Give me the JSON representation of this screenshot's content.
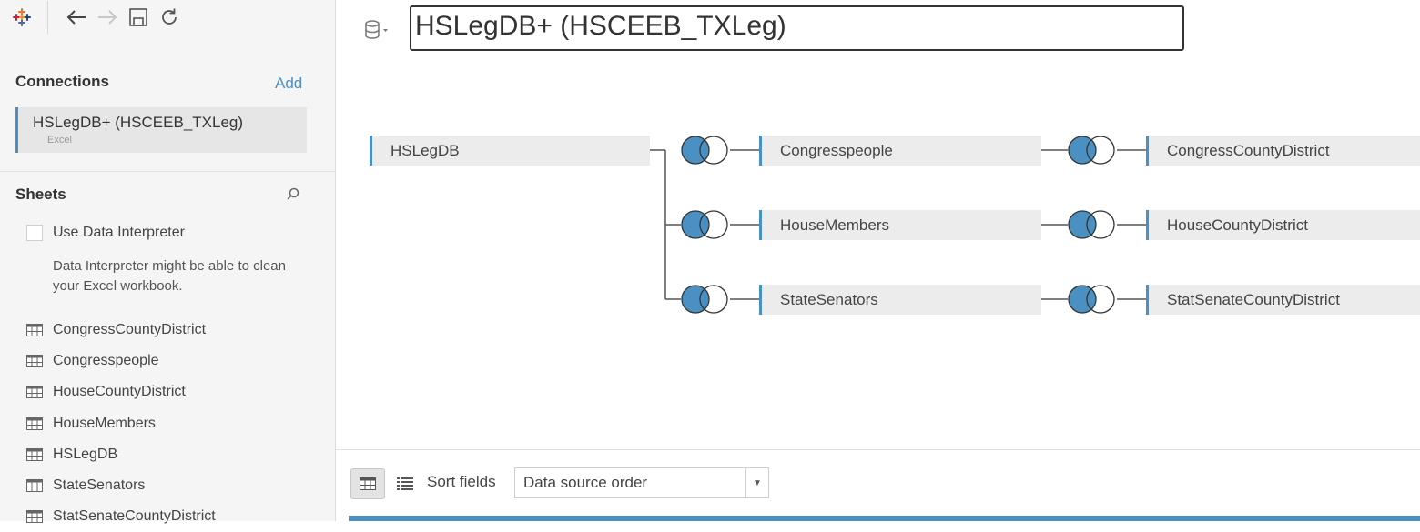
{
  "toolbar": {
    "logo_icon": "tableau-logo-icon",
    "back_icon": "arrow-left-icon",
    "forward_icon": "arrow-right-icon",
    "save_icon": "save-icon",
    "refresh_icon": "refresh-icon"
  },
  "connections": {
    "title": "Connections",
    "add_label": "Add",
    "items": [
      {
        "name": "HSLegDB+ (HSCEEB_TXLeg)",
        "type": "Excel"
      }
    ]
  },
  "sheets": {
    "title": "Sheets",
    "use_data_interpreter_label": "Use Data Interpreter",
    "data_interpreter_desc": "Data Interpreter might be able to clean your Excel workbook.",
    "items": [
      {
        "label": "CongressCountyDistrict"
      },
      {
        "label": "Congresspeople"
      },
      {
        "label": "HouseCountyDistrict"
      },
      {
        "label": "HouseMembers"
      },
      {
        "label": "HSLegDB"
      },
      {
        "label": "StateSenators"
      },
      {
        "label": "StatSenateCountyDistrict"
      }
    ]
  },
  "datasource": {
    "title": "HSLegDB+ (HSCEEB_TXLeg)"
  },
  "join_diagram": {
    "root": "HSLegDB",
    "join_type": "left",
    "rows": [
      {
        "table": "Congresspeople",
        "child": "CongressCountyDistrict"
      },
      {
        "table": "HouseMembers",
        "child": "HouseCountyDistrict"
      },
      {
        "table": "StateSenators",
        "child": "StatSenateCountyDistrict"
      }
    ]
  },
  "grid_controls": {
    "sort_label": "Sort fields",
    "sort_value": "Data source order"
  },
  "colors": {
    "accent": "#4a90c2",
    "join_fill": "#4a90c2",
    "table_bg": "#ececec",
    "sidebar_bg": "#f5f5f5"
  }
}
